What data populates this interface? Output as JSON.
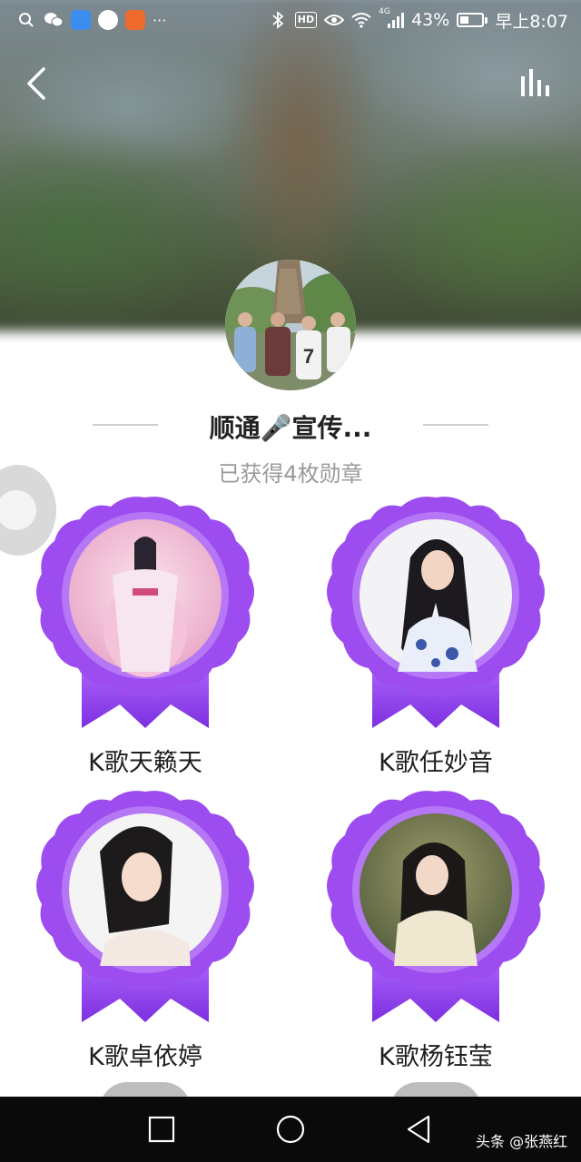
{
  "status_bar": {
    "battery_percent": "43%",
    "battery_level": 0.43,
    "time": "早上8:07",
    "hd": "HD",
    "net_type": "4G",
    "more": "···"
  },
  "profile": {
    "title": "顺通🎤宣传...",
    "subtitle": "已获得4枚勋章"
  },
  "badges": [
    {
      "label": "K歌天籁天"
    },
    {
      "label": "K歌任妙音"
    },
    {
      "label": "K歌卓依婷"
    },
    {
      "label": "K歌杨钰莹"
    }
  ],
  "watermark": "头条 @张燕红",
  "colors": {
    "badge_purple": "#8f3fe0",
    "badge_inner": "#a45ff0",
    "ribbon": "#9a4ef0"
  }
}
